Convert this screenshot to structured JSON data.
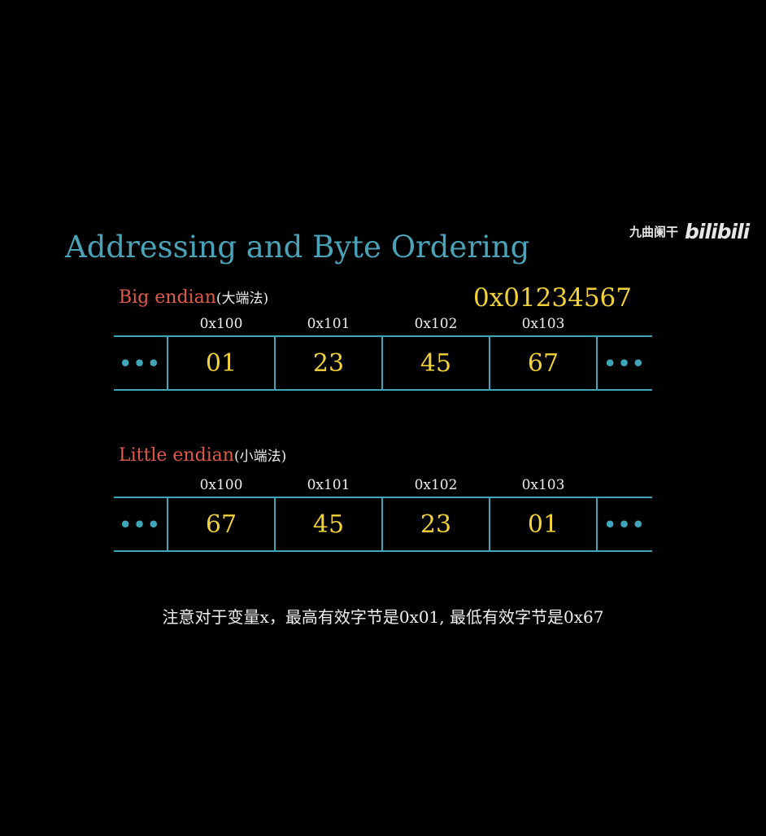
{
  "title": "Addressing and Byte Ordering",
  "watermark": {
    "text": "九曲阑干",
    "logo": "bilibili"
  },
  "value": "0x01234567",
  "ellipsis": "•••",
  "big_endian": {
    "label": "Big endian",
    "label_cn": "(大端法)",
    "addresses": [
      "0x100",
      "0x101",
      "0x102",
      "0x103"
    ],
    "bytes": [
      "01",
      "23",
      "45",
      "67"
    ]
  },
  "little_endian": {
    "label": "Little endian",
    "label_cn": "(小端法)",
    "addresses": [
      "0x100",
      "0x101",
      "0x102",
      "0x103"
    ],
    "bytes": [
      "67",
      "45",
      "23",
      "01"
    ]
  },
  "note": "注意对于变量x，最高有效字节是0x01, 最低有效字节是0x67",
  "colors": {
    "background": "#000000",
    "title": "#4aa3b8",
    "label": "#e05a4b",
    "value": "#f2d23a",
    "grid": "#3fa5b8"
  }
}
